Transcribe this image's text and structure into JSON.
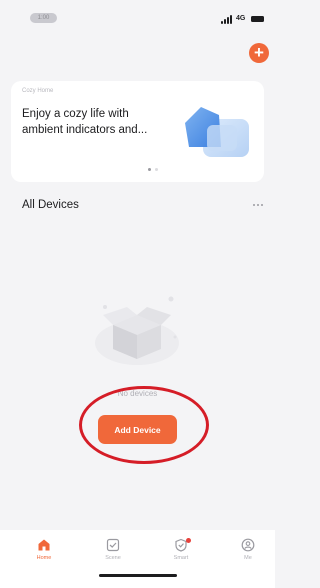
{
  "status_bar": {
    "time": "1:00",
    "network": "4G"
  },
  "banner": {
    "kicker": "Cozy Home",
    "text": "Enjoy a cozy life with ambient indicators and..."
  },
  "section": {
    "title": "All Devices"
  },
  "empty_state": {
    "message": "No devices"
  },
  "actions": {
    "add_device": "Add Device"
  },
  "tabs": [
    {
      "label": "Home",
      "icon": "home-icon",
      "active": true
    },
    {
      "label": "Scene",
      "icon": "checkbox-icon",
      "active": false
    },
    {
      "label": "Smart",
      "icon": "shield-icon",
      "active": false
    },
    {
      "label": "Me",
      "icon": "profile-icon",
      "active": false
    }
  ],
  "colors": {
    "accent": "#f0683a",
    "annotation": "#d51d27",
    "background": "#f4f4f6"
  }
}
